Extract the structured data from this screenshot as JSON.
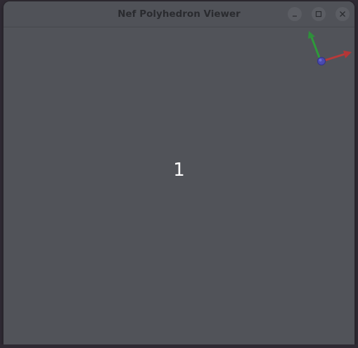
{
  "window": {
    "title": "Nef Polyhedron Viewer",
    "controls": {
      "minimize_icon": "minimize-icon",
      "maximize_icon": "maximize-icon",
      "close_icon": "close-icon"
    }
  },
  "viewport": {
    "frame_label": "1",
    "background_color": "#515359",
    "axes": {
      "x_color": "#b83a3a",
      "y_color": "#2e9a3a",
      "z_color": "#4a4ab0"
    }
  }
}
